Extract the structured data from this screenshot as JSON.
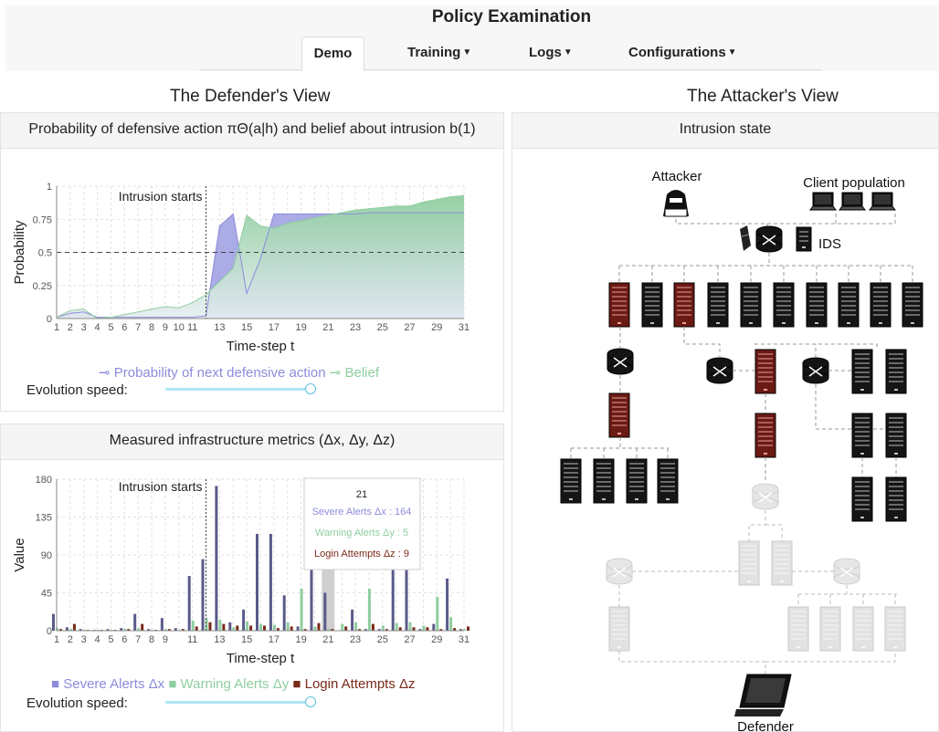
{
  "app": {
    "title": "Policy Examination"
  },
  "nav": {
    "tabs": [
      {
        "label": "Demo",
        "dropdown": false,
        "active": true
      },
      {
        "label": "Training",
        "dropdown": true
      },
      {
        "label": "Logs",
        "dropdown": true
      },
      {
        "label": "Configurations",
        "dropdown": true
      }
    ]
  },
  "defender": {
    "heading": "The Defender's View",
    "chart1": {
      "title": "Probability of defensive action πΘ(a|h) and belief about intrusion b(1)"
    },
    "chart2": {
      "title": "Measured infrastructure metrics (Δx, Δy, Δz)"
    },
    "speed_label": "Evolution speed:"
  },
  "attacker": {
    "heading": "The Attacker's View",
    "panel_title": "Intrusion state",
    "labels": {
      "attacker": "Attacker",
      "clients": "Client population",
      "ids": "IDS",
      "defender": "Defender"
    }
  },
  "colors": {
    "accent": "#8c8cdc",
    "belief": "#8fce9f",
    "login": "#7a2a1a",
    "compromised": "#b03a2e",
    "slider": "#5bc0de"
  },
  "chart_data": [
    {
      "type": "area",
      "title": "",
      "xlabel": "Time-step t",
      "ylabel": "Probability",
      "xlim": [
        1,
        31
      ],
      "ylim": [
        0,
        1
      ],
      "x_ticks": [
        "1",
        "2",
        "3",
        "4",
        "5",
        "6",
        "7",
        "8",
        "9",
        "10",
        "11",
        "13",
        "15",
        "17",
        "19",
        "21",
        "23",
        "25",
        "27",
        "29",
        "31"
      ],
      "y_ticks": [
        "0",
        "0.25",
        "0.5",
        "0.75",
        "1"
      ],
      "annotation": {
        "text": "Intrusion starts",
        "x": 12
      },
      "threshold": 0.5,
      "x": [
        1,
        2,
        3,
        4,
        5,
        6,
        7,
        8,
        9,
        10,
        11,
        12,
        13,
        14,
        15,
        16,
        17,
        18,
        19,
        20,
        21,
        22,
        23,
        24,
        25,
        26,
        27,
        28,
        29,
        30,
        31
      ],
      "series": [
        {
          "name": "Probability of next defensive action",
          "color": "#8c8cdc",
          "values": [
            0.01,
            0.04,
            0.05,
            0.01,
            0.01,
            0.01,
            0.01,
            0.01,
            0.01,
            0.01,
            0.01,
            0.02,
            0.7,
            0.79,
            0.19,
            0.45,
            0.79,
            0.79,
            0.79,
            0.79,
            0.79,
            0.79,
            0.79,
            0.8,
            0.8,
            0.8,
            0.8,
            0.8,
            0.8,
            0.8,
            0.8
          ]
        },
        {
          "name": "Belief",
          "color": "#8fce9f",
          "values": [
            0.01,
            0.06,
            0.07,
            0.0,
            0.01,
            0.03,
            0.05,
            0.07,
            0.09,
            0.08,
            0.12,
            0.18,
            0.28,
            0.38,
            0.78,
            0.7,
            0.68,
            0.72,
            0.74,
            0.76,
            0.78,
            0.8,
            0.82,
            0.83,
            0.84,
            0.85,
            0.85,
            0.88,
            0.9,
            0.92,
            0.93
          ]
        }
      ],
      "legend": "bottom-center"
    },
    {
      "type": "bar",
      "title": "",
      "xlabel": "Time-step t",
      "ylabel": "Value",
      "xlim": [
        1,
        31
      ],
      "ylim": [
        0,
        180
      ],
      "x_ticks": [
        "1",
        "2",
        "3",
        "4",
        "5",
        "6",
        "7",
        "8",
        "9",
        "11",
        "13",
        "15",
        "17",
        "19",
        "21",
        "23",
        "25",
        "27",
        "29",
        "31"
      ],
      "y_ticks": [
        "0",
        "45",
        "90",
        "135",
        "180"
      ],
      "annotation": {
        "text": "Intrusion starts",
        "x": 12
      },
      "x": [
        1,
        2,
        3,
        4,
        5,
        6,
        7,
        8,
        9,
        10,
        11,
        12,
        13,
        14,
        15,
        16,
        17,
        18,
        19,
        20,
        21,
        22,
        23,
        24,
        25,
        26,
        27,
        28,
        29,
        30,
        31
      ],
      "series": [
        {
          "name": "Severe Alerts Δx",
          "color": "#5a5a8a",
          "values": [
            20,
            4,
            2,
            1,
            2,
            3,
            20,
            2,
            15,
            3,
            65,
            85,
            172,
            10,
            25,
            115,
            115,
            42,
            5,
            164,
            45,
            0,
            25,
            2,
            2,
            72,
            72,
            2,
            8,
            62,
            2
          ]
        },
        {
          "name": "Warning Alerts Δy",
          "color": "#8fce9f",
          "values": [
            3,
            2,
            1,
            1,
            1,
            2,
            3,
            1,
            2,
            1,
            12,
            15,
            13,
            4,
            11,
            8,
            7,
            10,
            50,
            5,
            2,
            8,
            10,
            50,
            6,
            9,
            10,
            6,
            40,
            16,
            2
          ]
        },
        {
          "name": "Login Attempts Δz",
          "color": "#7a2a1a",
          "values": [
            2,
            8,
            1,
            1,
            1,
            2,
            8,
            1,
            2,
            2,
            5,
            10,
            8,
            6,
            6,
            6,
            3,
            5,
            2,
            9,
            2,
            5,
            2,
            8,
            2,
            4,
            4,
            4,
            2,
            3,
            5
          ]
        }
      ],
      "tooltip": {
        "header": "21",
        "lines": [
          "Severe Alerts Δx : 164",
          "Warning Alerts Δy : 5",
          "Login Attempts Δz : 9"
        ]
      },
      "highlight_x": 21,
      "legend": "bottom-center"
    }
  ]
}
